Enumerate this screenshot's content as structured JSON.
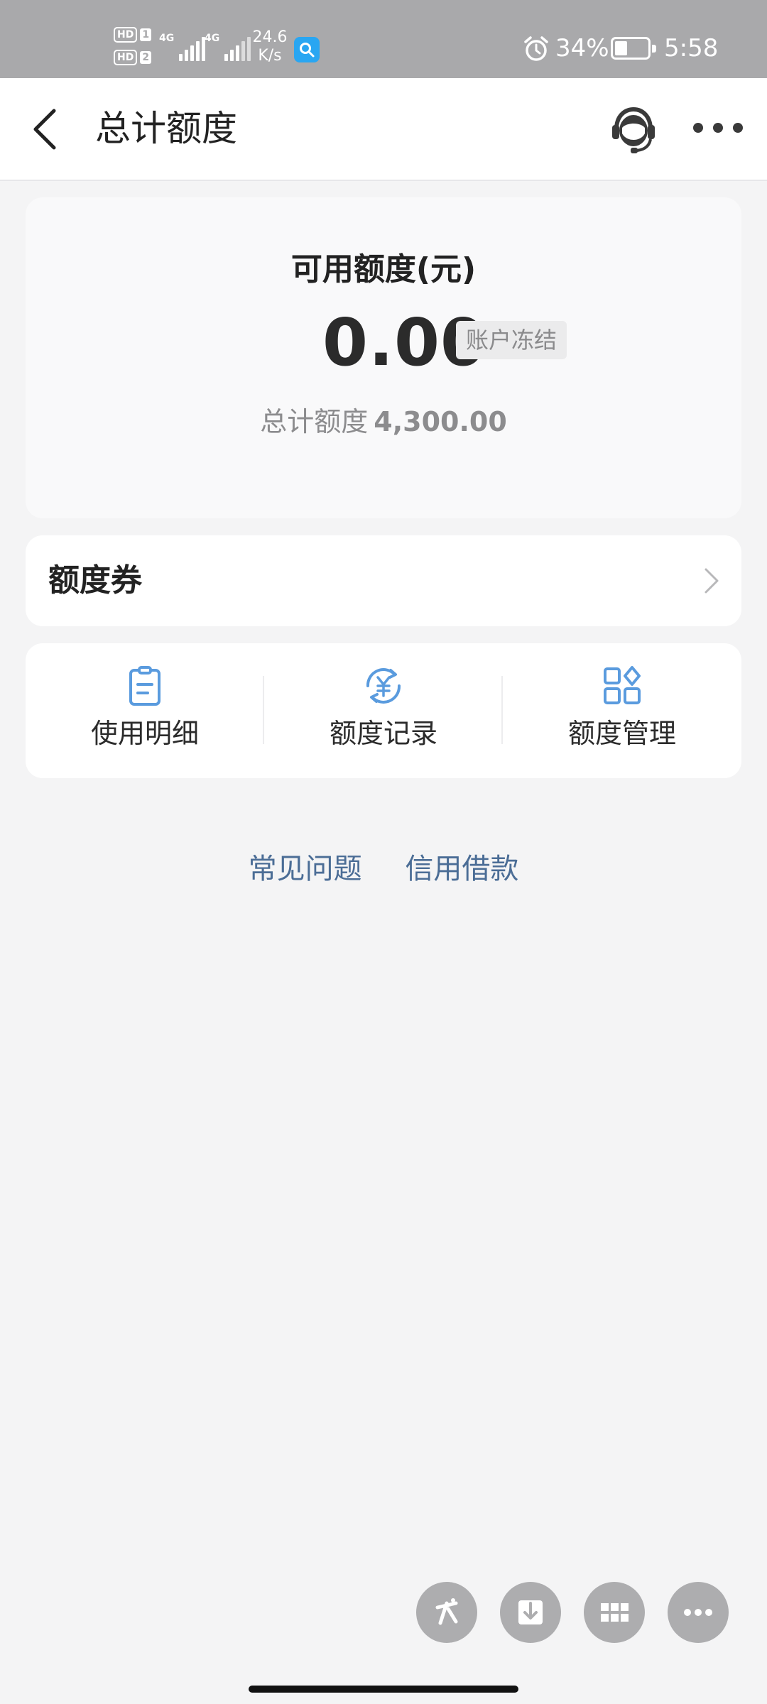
{
  "status_bar": {
    "sim1": "HD",
    "sim1_num": "1",
    "sim2": "HD",
    "sim2_num": "2",
    "network1": "4G",
    "network2": "4G",
    "speed_value": "24.6",
    "speed_unit": "K/s",
    "battery": "34%",
    "battery_level": 0.34,
    "time": "5:58"
  },
  "header": {
    "title": "总计额度"
  },
  "balance": {
    "label": "可用额度(元)",
    "value": "0.00",
    "badge": "账户冻结",
    "total_label": "总计额度",
    "total_value": "4,300.00"
  },
  "coupon": {
    "label": "额度券"
  },
  "actions": [
    {
      "label": "使用明细",
      "icon": "document-list-icon"
    },
    {
      "label": "额度记录",
      "icon": "yen-cycle-icon"
    },
    {
      "label": "额度管理",
      "icon": "apps-grid-icon"
    }
  ],
  "links": {
    "faq": "常见问题",
    "credit_loan": "信用借款"
  },
  "colors": {
    "accent_icon": "#5a9bde",
    "link": "#4b6d96",
    "status_bar": "#a9a9ab",
    "page_bg": "#f4f4f5"
  }
}
